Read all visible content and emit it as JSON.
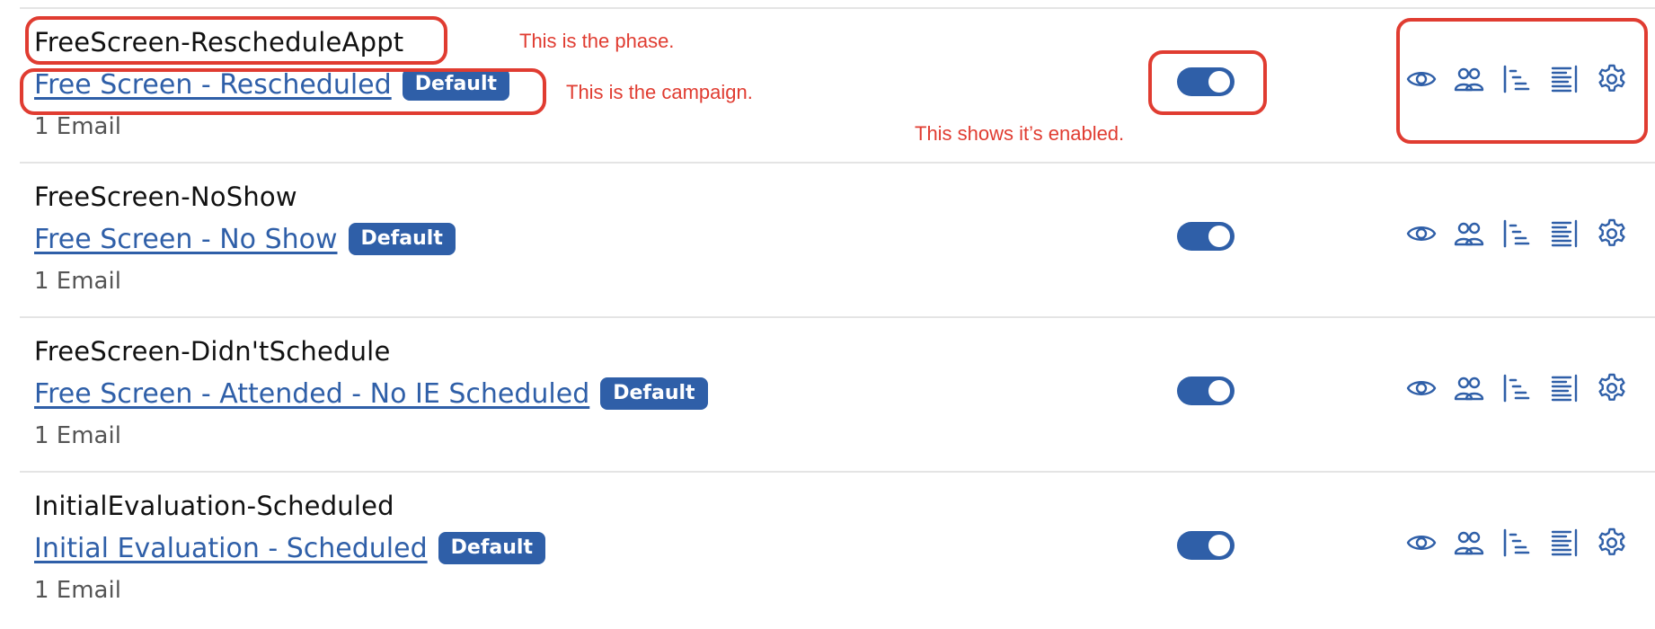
{
  "campaigns": [
    {
      "phase": "FreeScreen-RescheduleAppt",
      "campaign": "Free Screen - Rescheduled",
      "badge": "Default",
      "email_count": "1 Email",
      "enabled": true
    },
    {
      "phase": "FreeScreen-NoShow",
      "campaign": "Free Screen - No Show",
      "badge": "Default",
      "email_count": "1 Email",
      "enabled": true
    },
    {
      "phase": "FreeScreen-Didn'tSchedule",
      "campaign": "Free Screen - Attended - No IE Scheduled",
      "badge": "Default",
      "email_count": "1 Email",
      "enabled": true
    },
    {
      "phase": "InitialEvaluation-Scheduled",
      "campaign": "Initial Evaluation - Scheduled",
      "badge": "Default",
      "email_count": "1 Email",
      "enabled": true
    }
  ],
  "action_icons": [
    "eye-icon",
    "users-icon",
    "hierarchy-icon",
    "report-icon",
    "gear-icon"
  ],
  "annotations": {
    "phase_note": "This is the phase.",
    "campaign_note": "This is the campaign.",
    "enabled_note": "This shows it’s enabled."
  },
  "colors": {
    "accent": "#2f5fa8",
    "annotation": "#e03c31",
    "divider": "#e4e4e4",
    "phase_text": "#111111",
    "secondary_text": "#555555"
  }
}
